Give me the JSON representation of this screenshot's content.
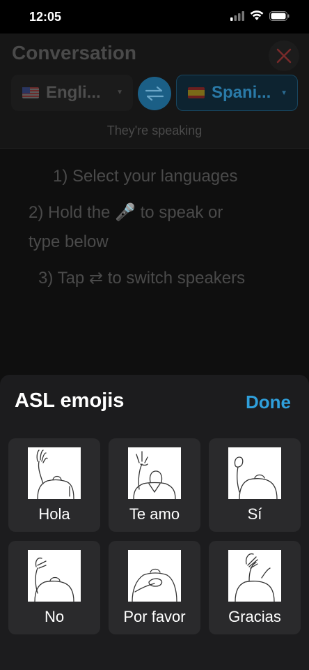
{
  "status": {
    "time": "12:05"
  },
  "header": {
    "title": "Conversation",
    "source_language": {
      "label": "Engli...",
      "flag": "us-flag-icon"
    },
    "target_language": {
      "label": "Spani...",
      "flag": "es-flag-icon"
    },
    "speaking_status": "They're speaking"
  },
  "instructions": [
    "1) Select your languages",
    "2) Hold the 🎤 to speak or",
    "type below",
    "3) Tap ⇄ to switch speakers"
  ],
  "sheet": {
    "title": "ASL emojis",
    "done_label": "Done",
    "tiles": [
      {
        "label": "Hola"
      },
      {
        "label": "Te amo"
      },
      {
        "label": "Sí"
      },
      {
        "label": "No"
      },
      {
        "label": "Por favor"
      },
      {
        "label": "Gracias"
      }
    ]
  },
  "colors": {
    "accent": "#2f9fdb",
    "sheet_bg": "#1c1c1e",
    "tile_bg": "#2a2a2c",
    "close_red": "#7a2a2a"
  }
}
